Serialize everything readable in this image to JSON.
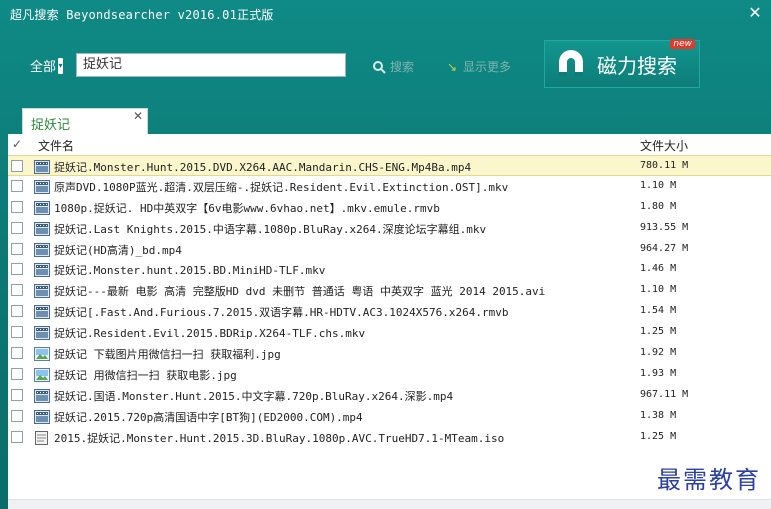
{
  "window": {
    "title": "超凡搜索 Beyondsearcher v2016.01正式版",
    "close": "✕"
  },
  "search": {
    "scope": "全部",
    "query": "捉妖记",
    "search_label": "搜索",
    "more_label": "显示更多"
  },
  "magnet": {
    "label": "磁力搜索",
    "badge": "new"
  },
  "tab": {
    "label": "捉妖记",
    "close": "✕"
  },
  "table": {
    "check_header": "✓",
    "name_header": "文件名",
    "size_header": "文件大小",
    "rows": [
      {
        "name": "捉妖记.Monster.Hunt.2015.DVD.X264.AAC.Mandarin.CHS-ENG.Mp4Ba.mp4",
        "size": "780.11 M",
        "icon": "video-file-icon",
        "selected": true
      },
      {
        "name": "原声DVD.1080P蓝光.超清.双层压缩-.捉妖记.Resident.Evil.Extinction.OST].mkv",
        "size": "1.10 M",
        "icon": "video-file-icon"
      },
      {
        "name": "1080p.捉妖记. HD中英双字【6v电影www.6vhao.net】.mkv.emule.rmvb",
        "size": "1.80 M",
        "icon": "video-file-icon"
      },
      {
        "name": "捉妖记.Last Knights.2015.中语字幕.1080p.BluRay.x264.深度论坛字幕组.mkv",
        "size": "913.55 M",
        "icon": "video-file-icon"
      },
      {
        "name": "捉妖记(HD高清)_bd.mp4",
        "size": "964.27 M",
        "icon": "video-file-icon"
      },
      {
        "name": "捉妖记.Monster.hunt.2015.BD.MiniHD-TLF.mkv",
        "size": "1.46 M",
        "icon": "video-file-icon"
      },
      {
        "name": "捉妖记---最新 电影 高清 完整版HD dvd 未删节 普通话 粤语 中英双字 蓝光 2014 2015.avi",
        "size": "1.10 M",
        "icon": "video-file-icon"
      },
      {
        "name": "捉妖记[.Fast.And.Furious.7.2015.双语字幕.HR-HDTV.AC3.1024X576.x264.rmvb",
        "size": "1.54 M",
        "icon": "video-file-icon"
      },
      {
        "name": "捉妖记.Resident.Evil.2015.BDRip.X264-TLF.chs.mkv",
        "size": "1.25 M",
        "icon": "video-file-icon"
      },
      {
        "name": "捉妖记 下载图片用微信扫一扫 获取福利.jpg",
        "size": "1.92 M",
        "icon": "image-file-icon"
      },
      {
        "name": "捉妖记 用微信扫一扫 获取电影.jpg",
        "size": "1.93 M",
        "icon": "image-file-icon"
      },
      {
        "name": "捉妖记.国语.Monster.Hunt.2015.中文字幕.720p.BluRay.x264.深影.mp4",
        "size": "967.11 M",
        "icon": "video-file-icon"
      },
      {
        "name": "捉妖记.2015.720p高清国语中字[BT狗](ED2000.COM).mp4",
        "size": "1.38 M",
        "icon": "video-file-icon"
      },
      {
        "name": "2015.捉妖记.Monster.Hunt.2015.3D.BluRay.1080p.AVC.TrueHD7.1-MTeam.iso",
        "size": "1.25 M",
        "icon": "disc-file-icon"
      }
    ]
  },
  "watermark": "最需教育"
}
